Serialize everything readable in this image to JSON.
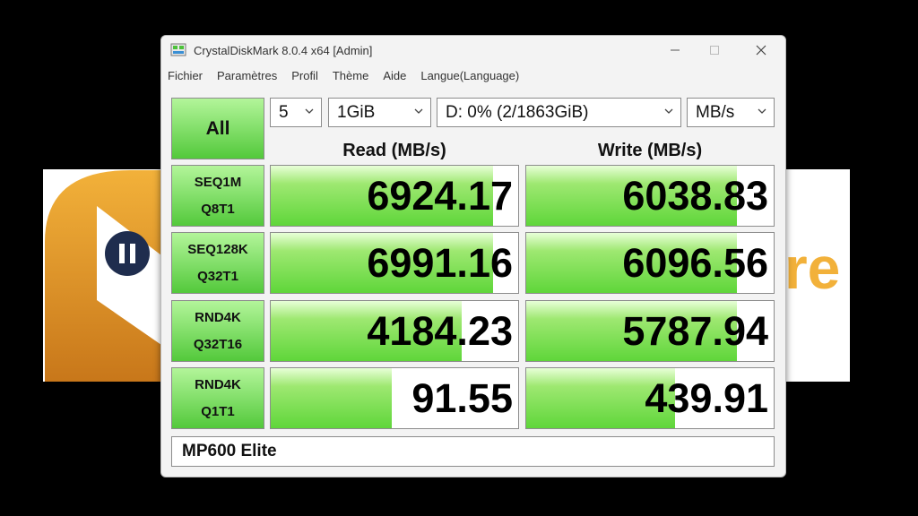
{
  "window": {
    "title": "CrystalDiskMark 8.0.4 x64 [Admin]"
  },
  "menu": [
    "Fichier",
    "Paramètres",
    "Profil",
    "Thème",
    "Aide",
    "Langue(Language)"
  ],
  "controls": {
    "all_label": "All",
    "count": "5",
    "size": "1GiB",
    "drive": "D: 0% (2/1863GiB)",
    "unit": "MB/s"
  },
  "columns": {
    "read": "Read (MB/s)",
    "write": "Write (MB/s)"
  },
  "tests": [
    {
      "line1": "SEQ1M",
      "line2": "Q8T1",
      "read": "6924.17",
      "write": "6038.83",
      "read_fill": 0.9,
      "write_fill": 0.85
    },
    {
      "line1": "SEQ128K",
      "line2": "Q32T1",
      "read": "6991.16",
      "write": "6096.56",
      "read_fill": 0.9,
      "write_fill": 0.85
    },
    {
      "line1": "RND4K",
      "line2": "Q32T16",
      "read": "4184.23",
      "write": "5787.94",
      "read_fill": 0.77,
      "write_fill": 0.85
    },
    {
      "line1": "RND4K",
      "line2": "Q1T1",
      "read": "91.55",
      "write": "439.91",
      "read_fill": 0.49,
      "write_fill": 0.6
    }
  ],
  "comment": "MP600 Elite",
  "colors": {
    "accent_green": "#5fd63a",
    "logo_orange": "#e39a1e",
    "logo_navy": "#1f2d4e"
  }
}
